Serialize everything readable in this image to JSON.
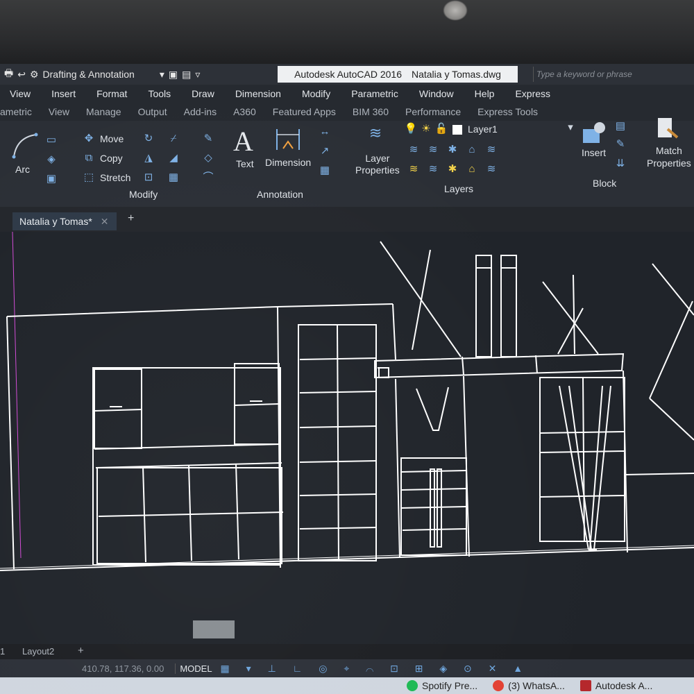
{
  "quick_access": {
    "workspace": "Drafting & Annotation"
  },
  "window": {
    "app_title": "Autodesk AutoCAD 2016",
    "file_name": "Natalia y Tomas.dwg",
    "search_placeholder": "Type a keyword or phrase"
  },
  "menubar": [
    "View",
    "Insert",
    "Format",
    "Tools",
    "Draw",
    "Dimension",
    "Modify",
    "Parametric",
    "Window",
    "Help",
    "Express"
  ],
  "ribbon_tabs": [
    "ametric",
    "View",
    "Manage",
    "Output",
    "Add-ins",
    "A360",
    "Featured Apps",
    "BIM 360",
    "Performance",
    "Express Tools"
  ],
  "ribbon": {
    "draw": {
      "arc": "Arc"
    },
    "modify": {
      "move": "Move",
      "copy": "Copy",
      "stretch": "Stretch",
      "panel": "Modify"
    },
    "annotation": {
      "text": "Text",
      "dimension": "Dimension",
      "panel": "Annotation"
    },
    "layers": {
      "layer_properties": "Layer\nProperties",
      "current_layer": "Layer1",
      "panel": "Layers"
    },
    "block": {
      "insert": "Insert",
      "match_properties": "Match\nProperties",
      "panel": "Block"
    }
  },
  "document_tab": {
    "label": "Natalia y Tomas*"
  },
  "layout_tabs": {
    "layout2": "Layout2"
  },
  "status": {
    "coordinates": "410.78, 117.36, 0.00",
    "model": "MODEL"
  },
  "taskbar": {
    "spotify": "Spotify Pre...",
    "whatsapp": "(3) WhatsA...",
    "autocad": "Autodesk A..."
  },
  "colors": {
    "canvas": "#20242a",
    "ribbon": "#2b2f36",
    "accent": "#7fb2e6"
  }
}
